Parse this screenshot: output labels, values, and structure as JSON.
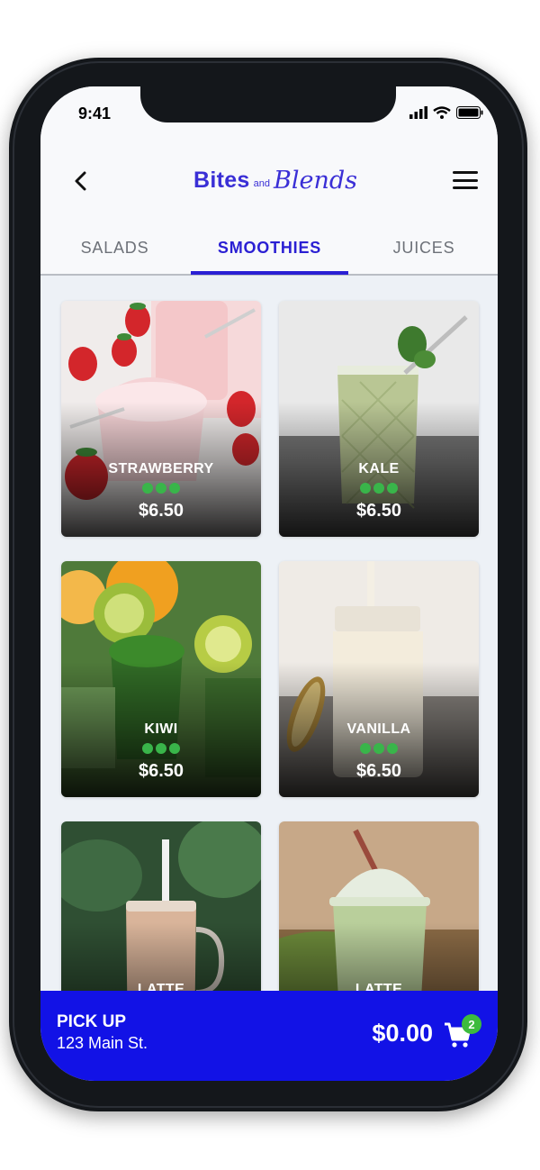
{
  "status": {
    "time": "9:41"
  },
  "brand": {
    "bites": "Bites",
    "and": "and",
    "blends": "Blends",
    "color": "#3a2fd6"
  },
  "tabs": [
    {
      "label": "SALADS",
      "active": false
    },
    {
      "label": "SMOOTHIES",
      "active": true
    },
    {
      "label": "JUICES",
      "active": false
    }
  ],
  "products": [
    {
      "name": "STRAWBERRY",
      "price": "$6.50"
    },
    {
      "name": "KALE",
      "price": "$6.50"
    },
    {
      "name": "KIWI",
      "price": "$6.50"
    },
    {
      "name": "VANILLA",
      "price": "$6.50"
    },
    {
      "name": "LATTE",
      "price": ""
    },
    {
      "name": "LATTE",
      "price": ""
    }
  ],
  "order": {
    "mode": "PICK UP",
    "address": "123 Main St.",
    "total": "$0.00",
    "cart_count": "2"
  },
  "colors": {
    "accent": "#1212e6",
    "tab_active": "#2a1fd3",
    "badge": "#3dbb3d"
  }
}
